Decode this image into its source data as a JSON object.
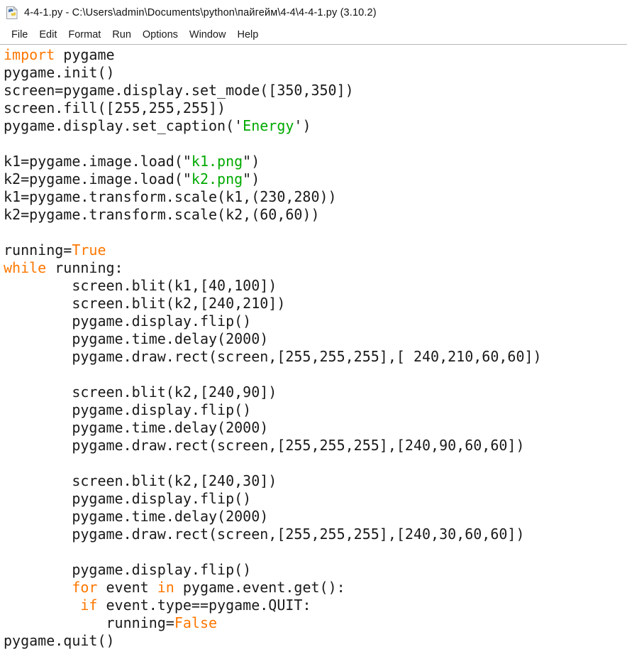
{
  "window": {
    "icon": "python-file-icon",
    "title": "4-4-1.py - C:\\Users\\admin\\Documents\\python\\пайгейм\\4-4\\4-4-1.py (3.10.2)"
  },
  "menubar": {
    "items": [
      {
        "label": "File"
      },
      {
        "label": "Edit"
      },
      {
        "label": "Format"
      },
      {
        "label": "Run"
      },
      {
        "label": "Options"
      },
      {
        "label": "Window"
      },
      {
        "label": "Help"
      }
    ]
  },
  "colors": {
    "keyword": "#ff7700",
    "string": "#00aa00",
    "text": "#1a1a1a",
    "background": "#ffffff",
    "separator": "#b8b8b8"
  },
  "editor": {
    "language": "python",
    "lines": [
      {
        "tokens": [
          {
            "t": "import",
            "c": "kw"
          },
          {
            "t": " pygame",
            "c": "pun"
          }
        ]
      },
      {
        "tokens": [
          {
            "t": "pygame.init()",
            "c": "pun"
          }
        ]
      },
      {
        "tokens": [
          {
            "t": "screen=pygame.display.set_mode([350,350])",
            "c": "pun"
          }
        ]
      },
      {
        "tokens": [
          {
            "t": "screen.fill([255,255,255])",
            "c": "pun"
          }
        ]
      },
      {
        "tokens": [
          {
            "t": "pygame.display.set_caption(",
            "c": "pun"
          },
          {
            "t": "'",
            "c": "pun"
          },
          {
            "t": "Energy",
            "c": "str"
          },
          {
            "t": "'",
            "c": "pun"
          },
          {
            "t": ")",
            "c": "pun"
          }
        ]
      },
      {
        "tokens": []
      },
      {
        "tokens": [
          {
            "t": "k1=pygame.image.load(",
            "c": "pun"
          },
          {
            "t": "\"",
            "c": "pun"
          },
          {
            "t": "k1.png",
            "c": "str"
          },
          {
            "t": "\"",
            "c": "pun"
          },
          {
            "t": ")",
            "c": "pun"
          }
        ]
      },
      {
        "tokens": [
          {
            "t": "k2=pygame.image.load(",
            "c": "pun"
          },
          {
            "t": "\"",
            "c": "pun"
          },
          {
            "t": "k2.png",
            "c": "str"
          },
          {
            "t": "\"",
            "c": "pun"
          },
          {
            "t": ")",
            "c": "pun"
          }
        ]
      },
      {
        "tokens": [
          {
            "t": "k1=pygame.transform.scale(k1,(230,280))",
            "c": "pun"
          }
        ]
      },
      {
        "tokens": [
          {
            "t": "k2=pygame.transform.scale(k2,(60,60))",
            "c": "pun"
          }
        ]
      },
      {
        "tokens": []
      },
      {
        "tokens": [
          {
            "t": "running=",
            "c": "pun"
          },
          {
            "t": "True",
            "c": "kw"
          }
        ]
      },
      {
        "tokens": [
          {
            "t": "while",
            "c": "kw"
          },
          {
            "t": " running:",
            "c": "pun"
          }
        ]
      },
      {
        "tokens": [
          {
            "t": "        screen.blit(k1,[40,100])",
            "c": "pun"
          }
        ]
      },
      {
        "tokens": [
          {
            "t": "        screen.blit(k2,[240,210])",
            "c": "pun"
          }
        ]
      },
      {
        "tokens": [
          {
            "t": "        pygame.display.flip()",
            "c": "pun"
          }
        ]
      },
      {
        "tokens": [
          {
            "t": "        pygame.time.delay(2000)",
            "c": "pun"
          }
        ]
      },
      {
        "tokens": [
          {
            "t": "        pygame.draw.rect(screen,[255,255,255],[ 240,210,60,60])",
            "c": "pun"
          }
        ]
      },
      {
        "tokens": []
      },
      {
        "tokens": [
          {
            "t": "        screen.blit(k2,[240,90])",
            "c": "pun"
          }
        ]
      },
      {
        "tokens": [
          {
            "t": "        pygame.display.flip()",
            "c": "pun"
          }
        ]
      },
      {
        "tokens": [
          {
            "t": "        pygame.time.delay(2000)",
            "c": "pun"
          }
        ]
      },
      {
        "tokens": [
          {
            "t": "        pygame.draw.rect(screen,[255,255,255],[240,90,60,60])",
            "c": "pun"
          }
        ]
      },
      {
        "tokens": []
      },
      {
        "tokens": [
          {
            "t": "        screen.blit(k2,[240,30])",
            "c": "pun"
          }
        ]
      },
      {
        "tokens": [
          {
            "t": "        pygame.display.flip()",
            "c": "pun"
          }
        ]
      },
      {
        "tokens": [
          {
            "t": "        pygame.time.delay(2000)",
            "c": "pun"
          }
        ]
      },
      {
        "tokens": [
          {
            "t": "        pygame.draw.rect(screen,[255,255,255],[240,30,60,60])",
            "c": "pun"
          }
        ]
      },
      {
        "tokens": []
      },
      {
        "tokens": [
          {
            "t": "        pygame.display.flip()",
            "c": "pun"
          }
        ]
      },
      {
        "tokens": [
          {
            "t": "        ",
            "c": "pun"
          },
          {
            "t": "for",
            "c": "kw"
          },
          {
            "t": " event ",
            "c": "pun"
          },
          {
            "t": "in",
            "c": "kw"
          },
          {
            "t": " pygame.event.get():",
            "c": "pun"
          }
        ]
      },
      {
        "tokens": [
          {
            "t": "         ",
            "c": "pun"
          },
          {
            "t": "if",
            "c": "kw"
          },
          {
            "t": " event.type==pygame.QUIT:",
            "c": "pun"
          }
        ]
      },
      {
        "tokens": [
          {
            "t": "            running=",
            "c": "pun"
          },
          {
            "t": "False",
            "c": "kw"
          }
        ]
      },
      {
        "tokens": [
          {
            "t": "pygame.quit()",
            "c": "pun"
          }
        ]
      }
    ]
  }
}
